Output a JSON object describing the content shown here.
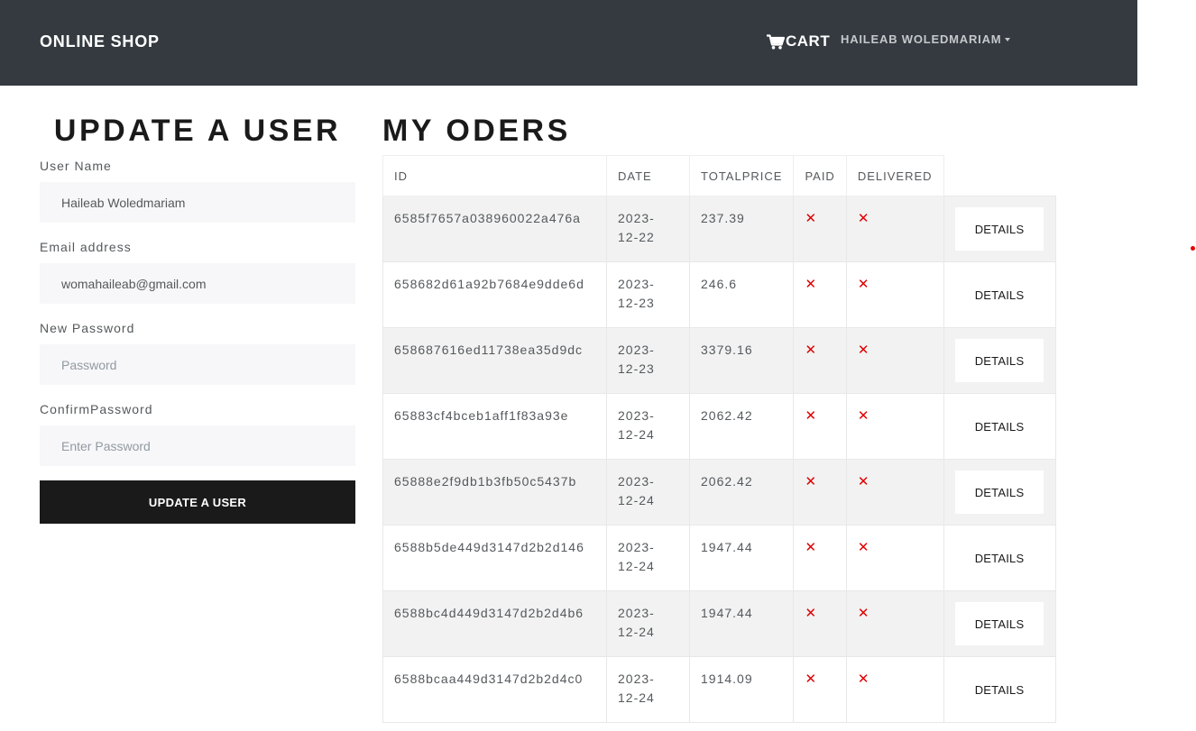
{
  "navbar": {
    "brand": "ONLINE SHOP",
    "cart_label": "CART",
    "user_label": "HAILEAB WOLEDMARIAM"
  },
  "form": {
    "title": "UPDATE A USER",
    "username_label": "User Name",
    "username_value": "Haileab Woledmariam",
    "email_label": "Email address",
    "email_value": "womahaileab@gmail.com",
    "password_label": "New Password",
    "password_placeholder": "Password",
    "confirm_label": "ConfirmPassword",
    "confirm_placeholder": "Enter Password",
    "submit_label": "UPDATE A USER"
  },
  "orders": {
    "title": "MY ODERS",
    "columns": [
      "ID",
      "DATE",
      "TOTALPRICE",
      "PAID",
      "DELIVERED"
    ],
    "details_label": "DETAILS",
    "not_mark": "✕",
    "rows": [
      {
        "id": "6585f7657a038960022a476a",
        "date_line1": "2023-",
        "date_line2": "12-22",
        "total": "237.39"
      },
      {
        "id": "658682d61a92b7684e9dde6d",
        "date_line1": "2023-",
        "date_line2": "12-23",
        "total": "246.6"
      },
      {
        "id": "658687616ed11738ea35d9dc",
        "date_line1": "2023-",
        "date_line2": "12-23",
        "total": "3379.16"
      },
      {
        "id": "65883cf4bceb1aff1f83a93e",
        "date_line1": "2023-",
        "date_line2": "12-24",
        "total": "2062.42"
      },
      {
        "id": "65888e2f9db1b3fb50c5437b",
        "date_line1": "2023-",
        "date_line2": "12-24",
        "total": "2062.42"
      },
      {
        "id": "6588b5de449d3147d2b2d146",
        "date_line1": "2023-",
        "date_line2": "12-24",
        "total": "1947.44"
      },
      {
        "id": "6588bc4d449d3147d2b2d4b6",
        "date_line1": "2023-",
        "date_line2": "12-24",
        "total": "1947.44"
      },
      {
        "id": "6588bcaa449d3147d2b2d4c0",
        "date_line1": "2023-",
        "date_line2": "12-24",
        "total": "1914.09"
      }
    ]
  },
  "colors": {
    "navbar_bg": "#343a40",
    "status_red": "#e00000",
    "button_dark": "#1a1a1a"
  },
  "icons": {
    "cart": "cart-icon",
    "caret": "caret-down-icon",
    "not_paid": "x-mark-icon"
  }
}
